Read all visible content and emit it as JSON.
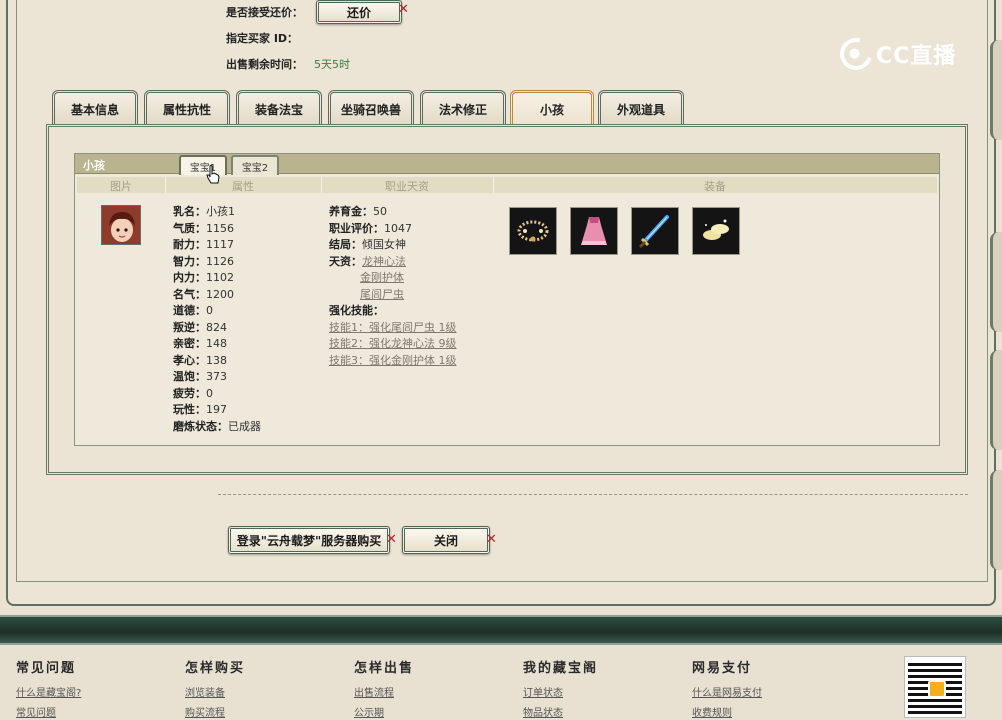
{
  "header": {
    "accept_counter_label": "是否接受还价：",
    "counter_button": "还价",
    "buyer_id_label": "指定买家 ID：",
    "remaining_label": "出售剩余时间：",
    "remaining_value": "5天5时"
  },
  "logo": {
    "text": "CC直播"
  },
  "main_tabs": [
    {
      "label": "基本信息"
    },
    {
      "label": "属性抗性"
    },
    {
      "label": "装备法宝"
    },
    {
      "label": "坐骑召唤兽"
    },
    {
      "label": "法术修正"
    },
    {
      "label": "小孩"
    },
    {
      "label": "外观道具"
    }
  ],
  "active_tab": "小孩",
  "child_panel": {
    "title": "小孩",
    "sub_tabs": [
      {
        "label": "宝宝1"
      },
      {
        "label": "宝宝2"
      }
    ],
    "columns": [
      "图片",
      "属性",
      "职业天资",
      "装备"
    ],
    "attributes": [
      {
        "label": "乳名：",
        "value": "小孩1"
      },
      {
        "label": "气质：",
        "value": "1156"
      },
      {
        "label": "耐力：",
        "value": "1117"
      },
      {
        "label": "智力：",
        "value": "1126"
      },
      {
        "label": "内力：",
        "value": "1102"
      },
      {
        "label": "名气：",
        "value": "1200"
      },
      {
        "label": "道德：",
        "value": "0"
      },
      {
        "label": "叛逆：",
        "value": "824"
      },
      {
        "label": "亲密：",
        "value": "148"
      },
      {
        "label": "孝心：",
        "value": "138"
      },
      {
        "label": "温饱：",
        "value": "373"
      },
      {
        "label": "疲劳：",
        "value": "0"
      },
      {
        "label": "玩性：",
        "value": "197"
      },
      {
        "label": "磨炼状态：",
        "value": "已成器"
      }
    ],
    "talent": {
      "fund_label": "养育金：",
      "fund_value": "50",
      "rating_label": "职业评价：",
      "rating_value": "1047",
      "ending_label": "结局：",
      "ending_value": "倾国女神",
      "skills_label": "天资：",
      "skills": [
        "龙神心法",
        "金刚护体",
        "尾闾尸虫"
      ],
      "enhanced_label": "强化技能：",
      "enhanced": [
        "技能1：强化尾闾尸虫 1级",
        "技能2：强化龙神心法 9级",
        "技能3：强化金刚护体 1级"
      ]
    },
    "equipment": [
      {
        "icon": "necklace-icon"
      },
      {
        "icon": "dress-icon"
      },
      {
        "icon": "sword-icon"
      },
      {
        "icon": "shoes-icon"
      }
    ]
  },
  "actions": {
    "login_button": "登录\"云舟载梦\"服务器购买",
    "close_button": "关闭"
  },
  "footer": {
    "columns": [
      {
        "title": "常见问题",
        "links": [
          "什么是藏宝阁?",
          "常见问题"
        ]
      },
      {
        "title": "怎样购买",
        "links": [
          "浏览装备",
          "购买流程"
        ]
      },
      {
        "title": "怎样出售",
        "links": [
          "出售流程",
          "公示期"
        ]
      },
      {
        "title": "我的藏宝阁",
        "links": [
          "订单状态",
          "物品状态"
        ]
      },
      {
        "title": "网易支付",
        "links": [
          "什么是网易支付",
          "收费规则"
        ]
      }
    ]
  },
  "colors": {
    "accent_green": "#3c7b41",
    "close_red": "#b3262b",
    "tab_active": "#b78a3d"
  }
}
